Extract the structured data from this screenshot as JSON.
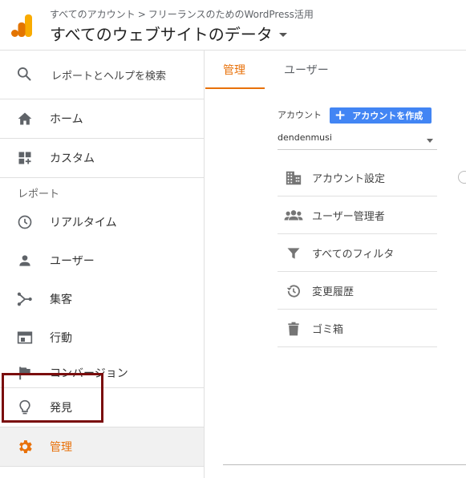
{
  "header": {
    "breadcrumb_account": "すべてのアカウント",
    "breadcrumb_separator": ">",
    "breadcrumb_property": "フリーランスのためのWordPress活用",
    "property_title": "すべてのウェブサイトのデータ"
  },
  "sidebar": {
    "search_label": "レポートとヘルプを検索",
    "home": "ホーム",
    "custom": "カスタム",
    "reports_section": "レポート",
    "realtime": "リアルタイム",
    "audience": "ユーザー",
    "acquisition": "集客",
    "behavior": "行動",
    "conversions": "コンバージョン",
    "discover": "発見",
    "admin": "管理"
  },
  "tabs": {
    "admin": "管理",
    "user": "ユーザー"
  },
  "account": {
    "label": "アカウント",
    "create_button": "アカウントを作成",
    "selected": "dendenmusi"
  },
  "account_menu": {
    "settings": "アカウント設定",
    "user_management": "ユーザー管理者",
    "filters": "すべてのフィルタ",
    "change_history": "変更履歴",
    "trash": "ゴミ箱"
  },
  "colors": {
    "accent": "#e8710a",
    "primary_button": "#4285f4",
    "highlight_border": "#7a0d0d"
  }
}
